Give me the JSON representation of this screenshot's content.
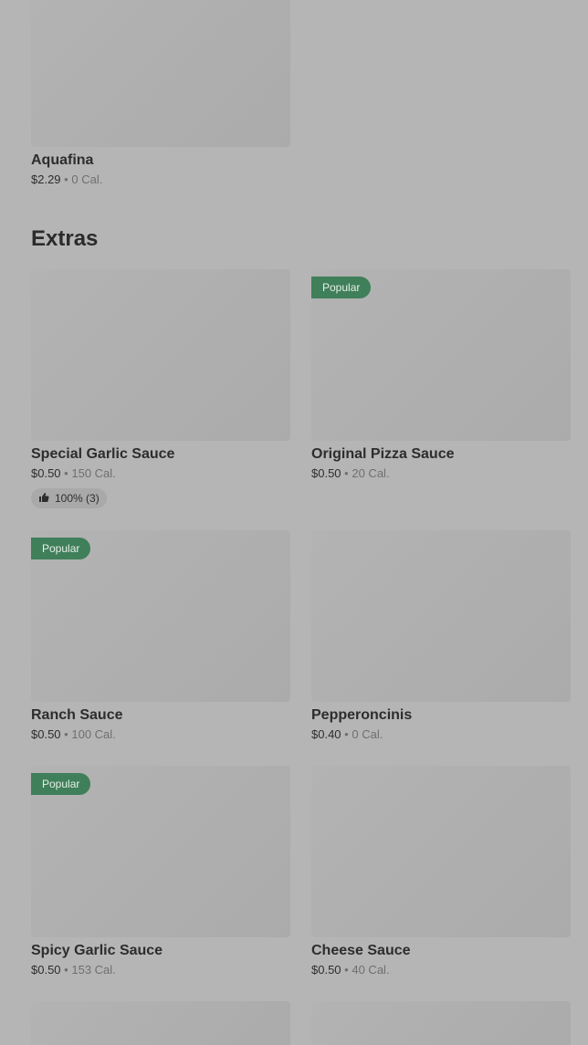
{
  "aquafina": {
    "name": "Aquafina",
    "price": "$2.29",
    "cal": "0 Cal."
  },
  "section_title": "Extras",
  "items": [
    {
      "name": "Special Garlic Sauce",
      "price": "$0.50",
      "cal": "150 Cal.",
      "rating": "100% (3)"
    },
    {
      "name": "Original Pizza Sauce",
      "price": "$0.50",
      "cal": "20 Cal.",
      "badge": "Popular"
    },
    {
      "name": "Ranch Sauce",
      "price": "$0.50",
      "cal": "100 Cal.",
      "badge": "Popular"
    },
    {
      "name": "Pepperoncinis",
      "price": "$0.40",
      "cal": "0 Cal."
    },
    {
      "name": "Spicy Garlic Sauce",
      "price": "$0.50",
      "cal": "153 Cal.",
      "badge": "Popular"
    },
    {
      "name": "Cheese Sauce",
      "price": "$0.50",
      "cal": "40 Cal."
    }
  ],
  "separator": "•",
  "icons": {
    "rating": "thumbs-up-icon"
  },
  "colors": {
    "badge_bg": "#3f7f5a",
    "overlay_bg": "#b5b5b5"
  }
}
